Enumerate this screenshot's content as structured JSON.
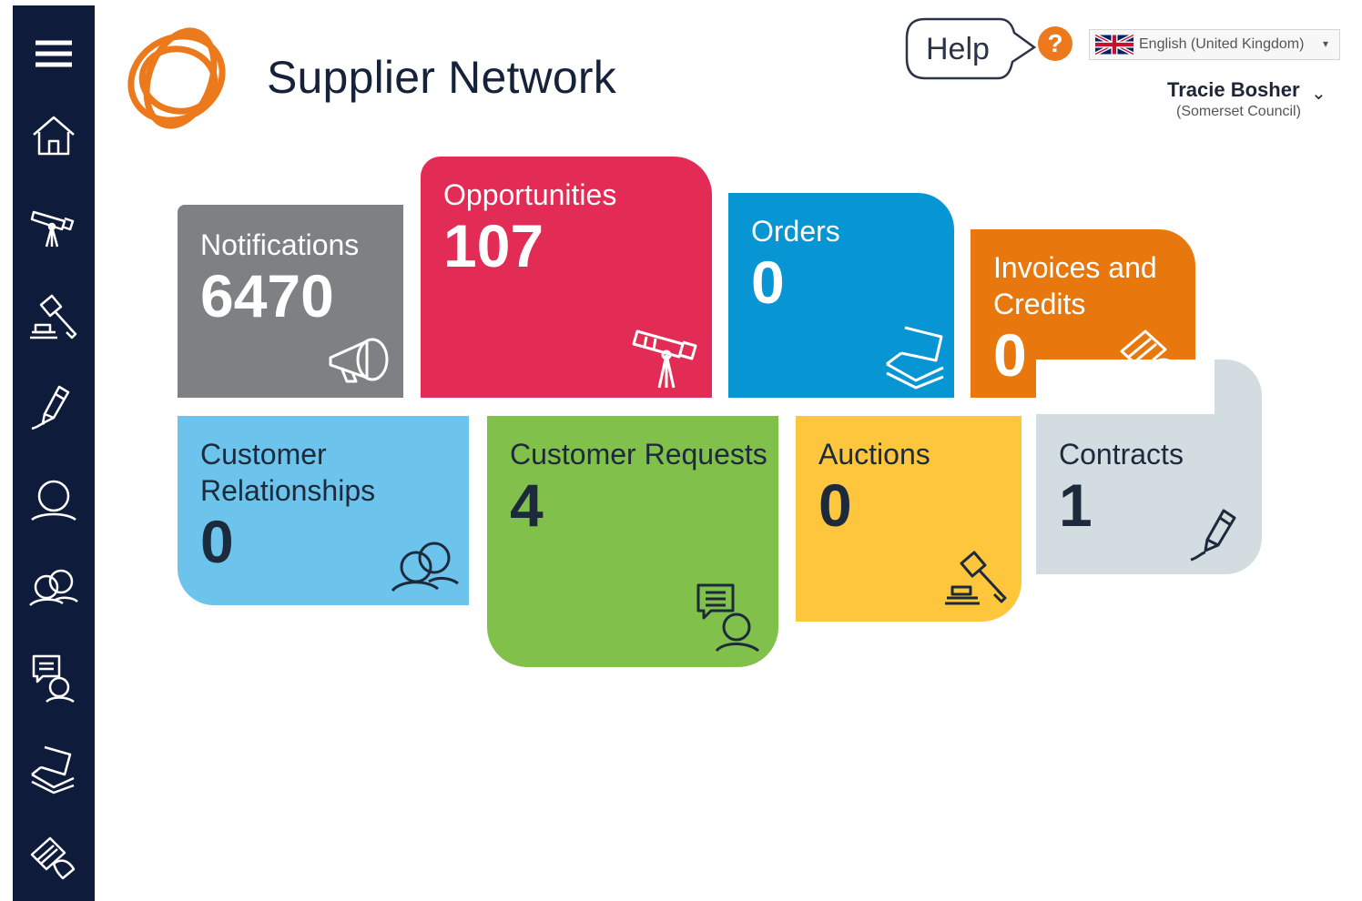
{
  "sidebar": {
    "items": [
      {
        "icon": "menu-icon"
      },
      {
        "icon": "home-icon"
      },
      {
        "icon": "telescope-icon"
      },
      {
        "icon": "gavel-icon"
      },
      {
        "icon": "pen-icon"
      },
      {
        "icon": "person-icon"
      },
      {
        "icon": "people-icon"
      },
      {
        "icon": "chat-person-icon"
      },
      {
        "icon": "papers-icon"
      },
      {
        "icon": "invoice-icon"
      }
    ]
  },
  "header": {
    "title": "Supplier Network",
    "help_label": "Help",
    "help_icon": "?",
    "language": "English (United Kingdom)",
    "language_caret": "▾",
    "user_name": "Tracie Bosher",
    "user_caret": "⌄",
    "user_org": "(Somerset Council)"
  },
  "tiles": {
    "notifications": {
      "label": "Notifications",
      "count": "6470",
      "icon": "megaphone-icon"
    },
    "opportunities": {
      "label": "Opportunities",
      "count": "107",
      "icon": "telescope-icon"
    },
    "orders": {
      "label": "Orders",
      "count": "0",
      "icon": "papers-icon"
    },
    "invoices": {
      "label": "Invoices and Credits",
      "count": "0",
      "icon": "invoice-icon"
    },
    "customer_relationships": {
      "label": "Customer Relationships",
      "count": "0",
      "icon": "people-icon"
    },
    "customer_requests": {
      "label": "Customer Requests",
      "count": "4",
      "icon": "chat-person-icon"
    },
    "auctions": {
      "label": "Auctions",
      "count": "0",
      "icon": "gavel-icon"
    },
    "contracts": {
      "label": "Contracts",
      "count": "1",
      "icon": "pen-icon"
    }
  },
  "colors": {
    "sidebar": "#0f1b3b",
    "brand_orange": "#ec7a1c",
    "notifications": "#7d8183",
    "opportunities": "#e22b55",
    "orders": "#0795d4",
    "invoices": "#e8780e",
    "customer_relationships": "#6cc4ec",
    "customer_requests": "#80c04b",
    "auctions": "#fec63c",
    "contracts": "#d3dde1"
  }
}
